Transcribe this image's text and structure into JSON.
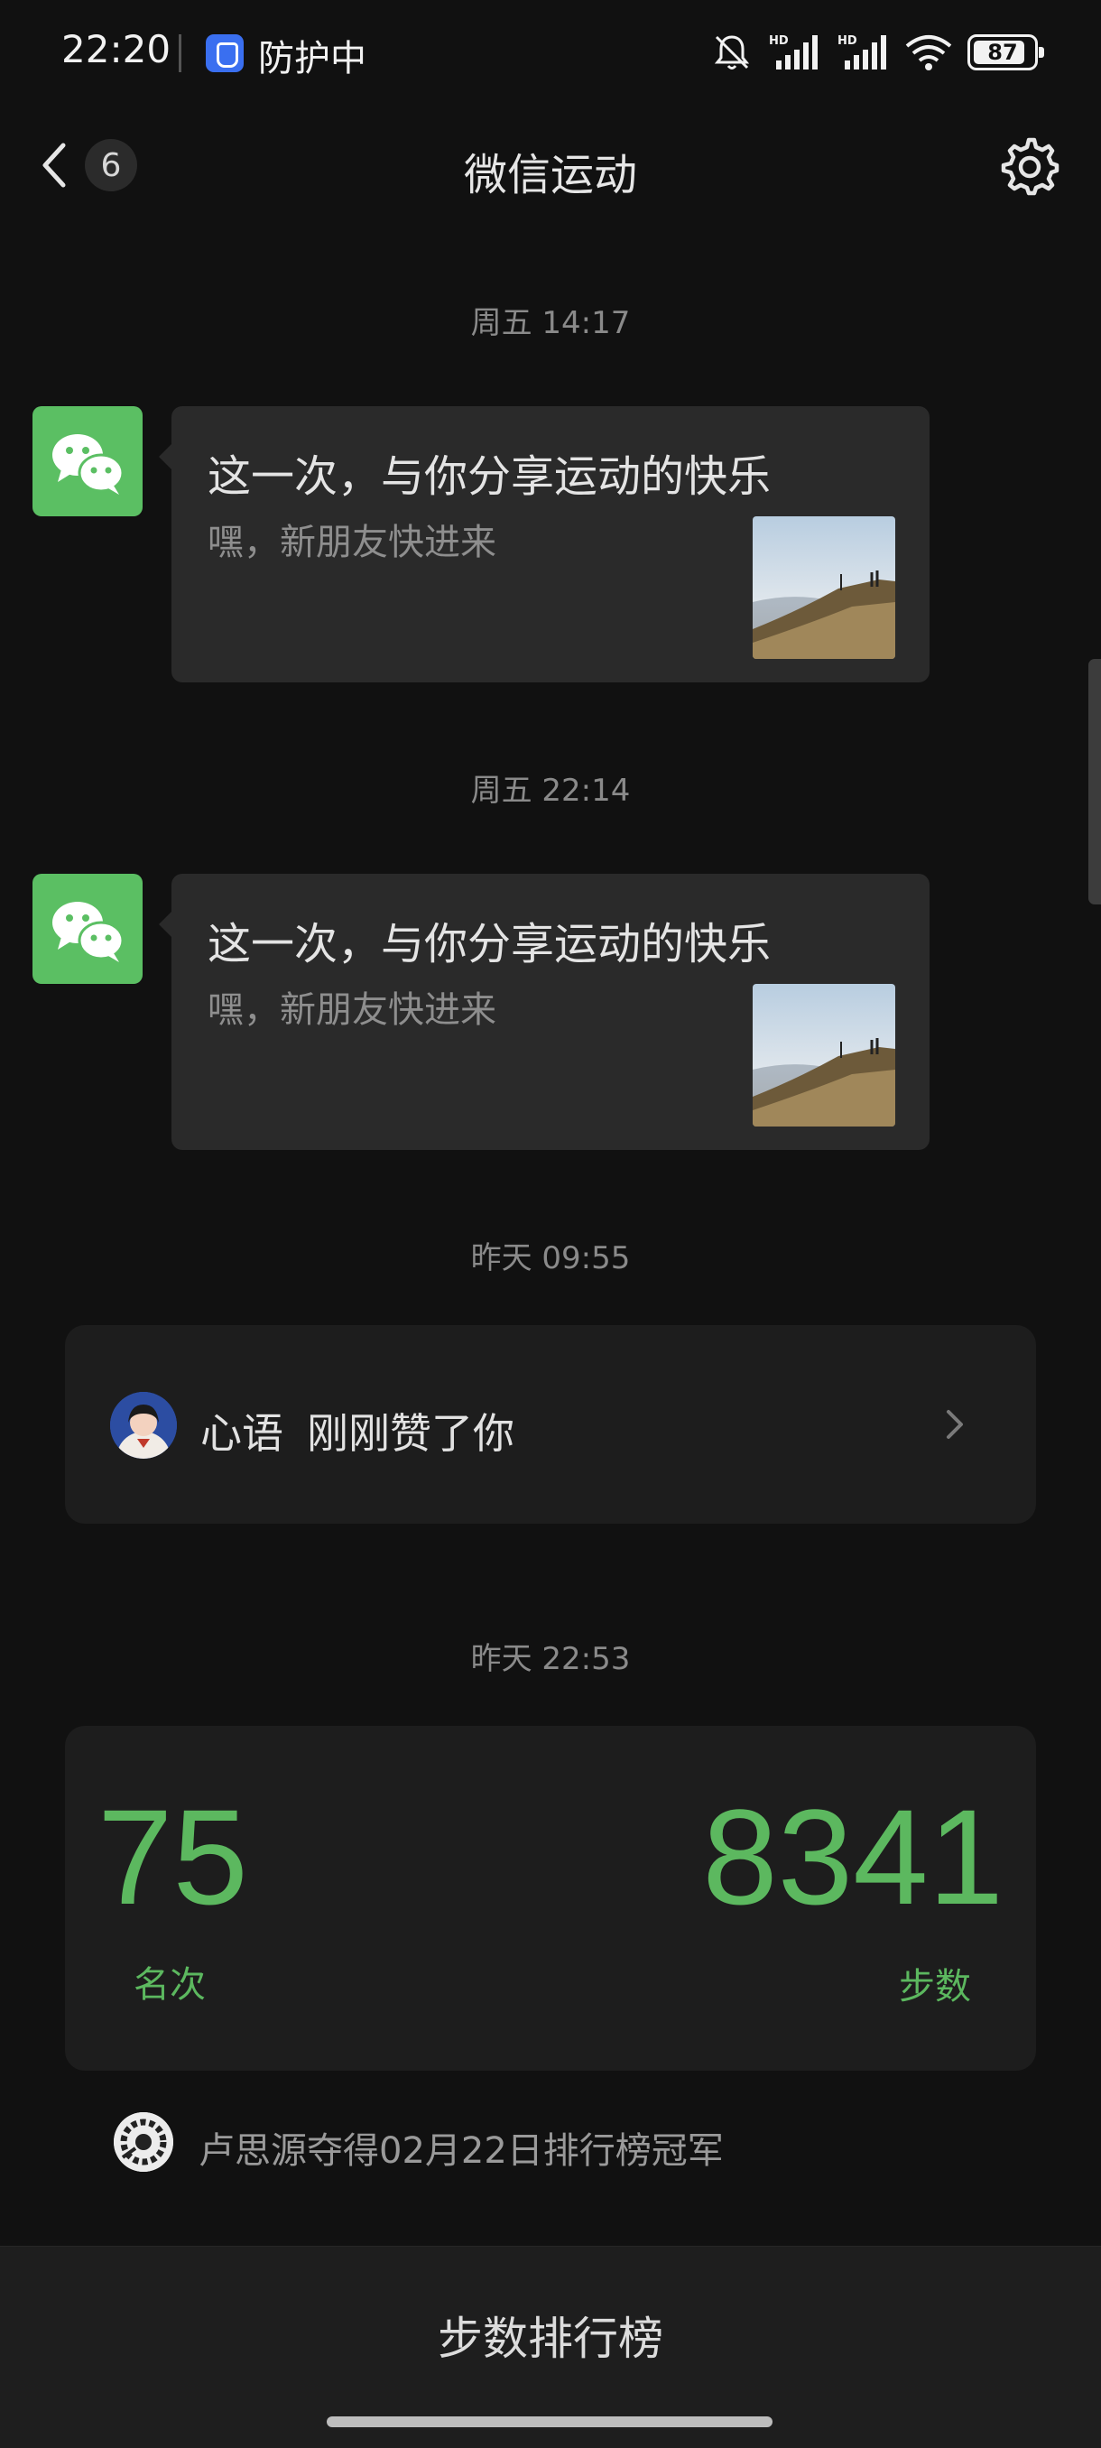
{
  "status_bar": {
    "time": "22:20",
    "protect_label": "防护中",
    "battery": "87",
    "icons": [
      "mute-bell-icon",
      "hd-signal-icon",
      "hd-signal-icon",
      "wifi-icon",
      "battery-icon"
    ]
  },
  "nav": {
    "unread_count": "6",
    "title": "微信运动",
    "icons": [
      "back-chevron-icon",
      "gear-icon"
    ]
  },
  "messages": [
    {
      "timestamp": "周五 14:17",
      "title": "这一次，与你分享运动的快乐",
      "description": "嘿，新朋友快进来",
      "avatar_icon": "wechat-icon",
      "thumbnail": "hiking-mountain-photo"
    },
    {
      "timestamp": "周五 22:14",
      "title": "这一次，与你分享运动的快乐",
      "description": "嘿，新朋友快进来",
      "avatar_icon": "wechat-icon",
      "thumbnail": "hiking-mountain-photo"
    }
  ],
  "like": {
    "timestamp": "昨天 09:55",
    "name": "心语",
    "text": "刚刚赞了你"
  },
  "rank": {
    "timestamp": "昨天 22:53",
    "rank_value": "75",
    "rank_label": "名次",
    "steps_value": "8341",
    "steps_label": "步数",
    "champion_text": "卢思源夺得02月22日排行榜冠军"
  },
  "bottom": {
    "tab_label": "步数排行榜"
  },
  "colors": {
    "accent_green": "#5cb85f",
    "wechat_green": "#5bbf63",
    "background": "#111111",
    "card": "#1d1d1d"
  }
}
